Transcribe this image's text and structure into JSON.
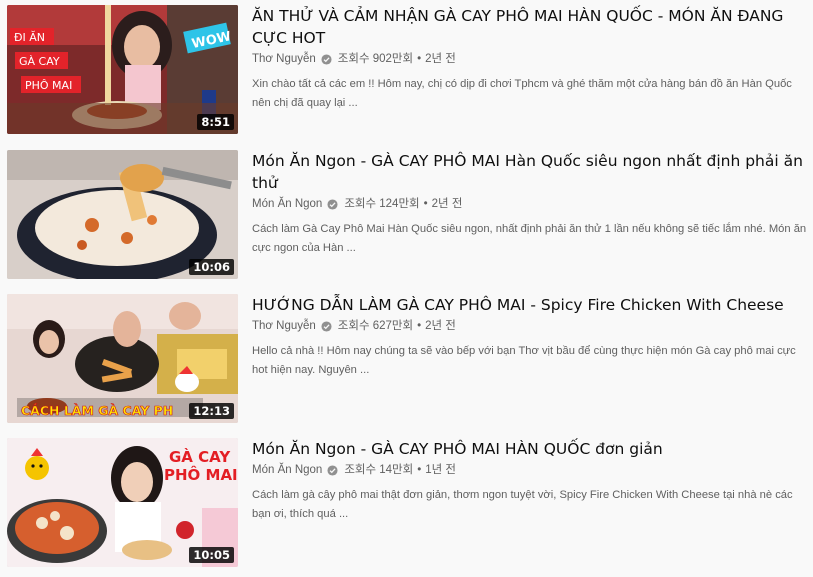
{
  "videos": [
    {
      "title": "ĂN THỬ VÀ CẢM NHẬN GÀ CAY PHÔ MAI HÀN QUỐC - MÓN ĂN ĐANG CỰC HOT",
      "channel": "Thơ Nguyễn",
      "verified_icon": "check-circle-icon",
      "views": "조회수 902만회",
      "age": "2년 전",
      "description": "Xin chào tất cả các em !! Hôm nay, chị có dịp đi chơi Tphcm và ghé thăm một cửa hàng bán đồ ăn Hàn Quốc nên chị đã quay lại ...",
      "duration": "8:51",
      "thumb_texts": [
        "ĐI ĂN",
        "GÀ CAY",
        "PHÔ MAI",
        "WOW"
      ]
    },
    {
      "title": "Món Ăn Ngon - GÀ CAY PHÔ MAI Hàn Quốc siêu ngon nhất định phải ăn thử",
      "channel": "Món Ăn Ngon",
      "verified_icon": "check-circle-icon",
      "views": "조회수 124만회",
      "age": "2년 전",
      "description": "Cách làm Gà Cay Phô Mai Hàn Quốc siêu ngon, nhất định phải ăn thử 1 lần nếu không sẽ tiếc lắm nhé. Món ăn cực ngon của Hàn ...",
      "duration": "10:06",
      "thumb_texts": []
    },
    {
      "title": "HƯỚNG DẪN LÀM GÀ CAY PHÔ MAI - Spicy Fire Chicken With Cheese",
      "channel": "Thơ Nguyễn",
      "verified_icon": "check-circle-icon",
      "views": "조회수 627만회",
      "age": "2년 전",
      "description": "Hello cả nhà !! Hôm nay chúng ta sẽ vào bếp với bạn Thơ vịt bầu để cùng thực hiện món Gà cay phô mai cực hot hiện nay. Nguyên ...",
      "duration": "12:13",
      "thumb_texts": [
        "CÁCH LÀM GÀ CAY PH"
      ]
    },
    {
      "title": "Món Ăn Ngon - GÀ CAY PHÔ MAI HÀN QUỐC đơn giản",
      "channel": "Món Ăn Ngon",
      "verified_icon": "check-circle-icon",
      "views": "조회수 14만회",
      "age": "1년 전",
      "description": "Cách làm gà cây phô mai thật đơn giản, thơm ngon tuyệt vời, Spicy Fire Chicken With Cheese tại nhà nè các bạn ơi, thích quá ...",
      "duration": "10:05",
      "thumb_texts": [
        "GÀ CAY",
        "PHÔ MAI"
      ]
    }
  ],
  "separator": "•",
  "colors": {
    "background": "#f9f9f9",
    "title": "#0f0f0f",
    "meta": "#606060",
    "duration_bg": "#000000",
    "thumb_label_red": "#e3232a",
    "thumb_title_red": "#e31e24"
  }
}
